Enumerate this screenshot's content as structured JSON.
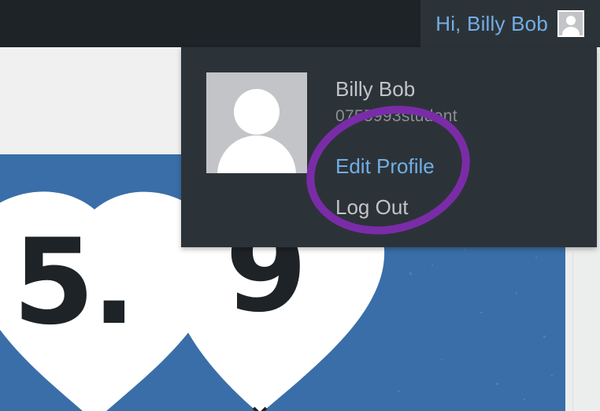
{
  "adminbar": {
    "greeting": "Hi, Billy Bob",
    "avatar_icon": "user-avatar-icon"
  },
  "dropdown": {
    "display_name": "Billy Bob",
    "username": "0755993student",
    "edit_profile": "Edit Profile",
    "log_out": "Log Out",
    "avatar_icon": "user-avatar-icon"
  },
  "banner": {
    "version_left": "5.",
    "version_right": "9"
  },
  "colors": {
    "adminbar_bg": "#1d2327",
    "menu_bg": "#2c3338",
    "link": "#72aee6",
    "text": "#c3c4c7",
    "banner_blue": "#3a6ea8",
    "annotation_purple": "#7a2ca8"
  }
}
